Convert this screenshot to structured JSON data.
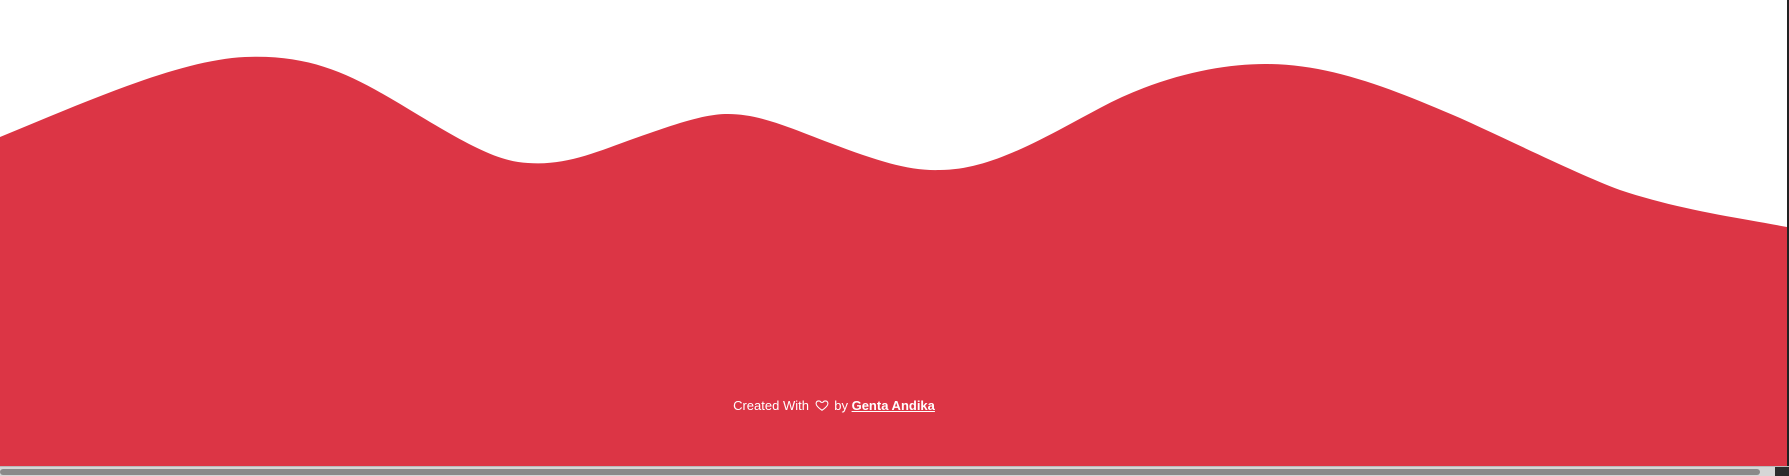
{
  "theme": {
    "wave_color": "#dc3545",
    "background": "#ffffff",
    "text_color": "#ffffff"
  },
  "footer": {
    "prefix": "Created With",
    "icon": "heart-outline-icon",
    "connector": "by",
    "author": "Genta Andika"
  }
}
